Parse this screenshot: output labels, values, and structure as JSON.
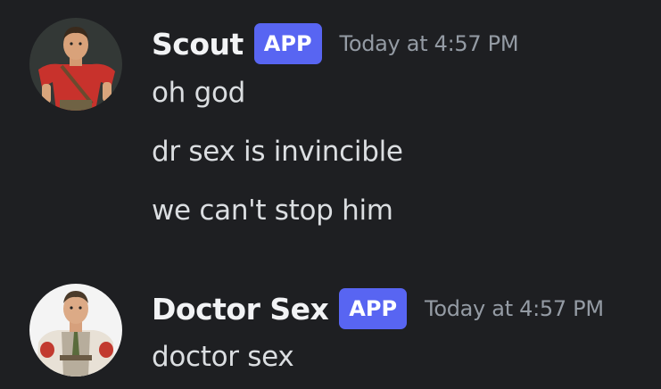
{
  "messages": [
    {
      "author": "Scout",
      "badge": "APP",
      "timestamp": "Today at 4:57 PM",
      "lines": [
        "oh god",
        "dr sex is invincible",
        "we can't stop him"
      ]
    },
    {
      "author": "Doctor Sex",
      "badge": "APP",
      "timestamp": "Today at 4:57 PM",
      "lines": [
        "doctor sex"
      ]
    }
  ],
  "colors": {
    "background": "#1e1f22",
    "badge": "#5865f2",
    "username": "#f2f3f5",
    "timestamp": "#949ba4",
    "message_text": "#dbdee1"
  }
}
